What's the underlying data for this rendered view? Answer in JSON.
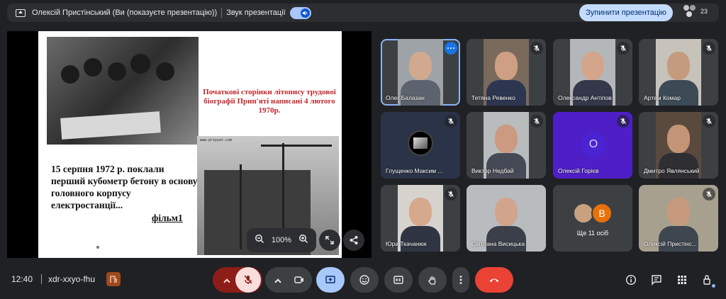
{
  "topbar": {
    "presenter_text": "Олексій Пристінський (Ви (показуєте презентацію))",
    "sound_label": "Звук презентації",
    "stop_button": "Зупинити презентацію",
    "participant_count": "23"
  },
  "slide": {
    "title": "Початкові сторінки літопису трудової біографії Прип'яті написані 4 лютого 1970р.",
    "body": "15 серпня 1972 р. поклали перший кубометр бетону в основу головного корпусу електростанції...",
    "link": "фільм1",
    "photo_caption": "www.pripyat.com"
  },
  "zoom": {
    "level": "100%"
  },
  "participants": [
    {
      "name": "Олег Балазан",
      "state": "speaking"
    },
    {
      "name": "Тетяна Ревенко",
      "state": "muted"
    },
    {
      "name": "Олександр Антіпов",
      "state": "muted"
    },
    {
      "name": "Артем Комар",
      "state": "muted"
    },
    {
      "name": "Глущенко Максим ...",
      "state": "muted"
    },
    {
      "name": "Виктор Недбай",
      "state": "muted"
    },
    {
      "name": "Олексій Горієв",
      "state": "muted",
      "avatar_letter": "О"
    },
    {
      "name": "Дмитро Являнський",
      "state": "muted"
    },
    {
      "name": "Юра Ткачанюк",
      "state": "muted"
    },
    {
      "name": "Світлана Висицька",
      "state": "none"
    },
    {
      "name": "Ще 11 осіб",
      "state": "none",
      "avatar_letter": "В"
    },
    {
      "name": "Олексій Пристінс...",
      "state": "muted"
    }
  ],
  "bottom": {
    "time": "12:40",
    "meeting_code": "xdr-xxyo-fhu"
  },
  "colors": {
    "background": "#202124",
    "end_call": "#ea4335",
    "mic_off": "#f9dedc",
    "present_active": "#a8c7fa",
    "accent": "#8ab4f8"
  },
  "icons": [
    "present-icon",
    "volume-icon",
    "people-icon",
    "zoom-out-icon",
    "zoom-in-icon",
    "fullscreen-icon",
    "share-icon",
    "mic-off-icon",
    "camera-icon",
    "present-screen-icon",
    "emoji-icon",
    "captions-icon",
    "hand-icon",
    "more-icon",
    "hangup-icon",
    "info-icon",
    "chat-icon",
    "apps-icon",
    "host-controls-icon"
  ]
}
